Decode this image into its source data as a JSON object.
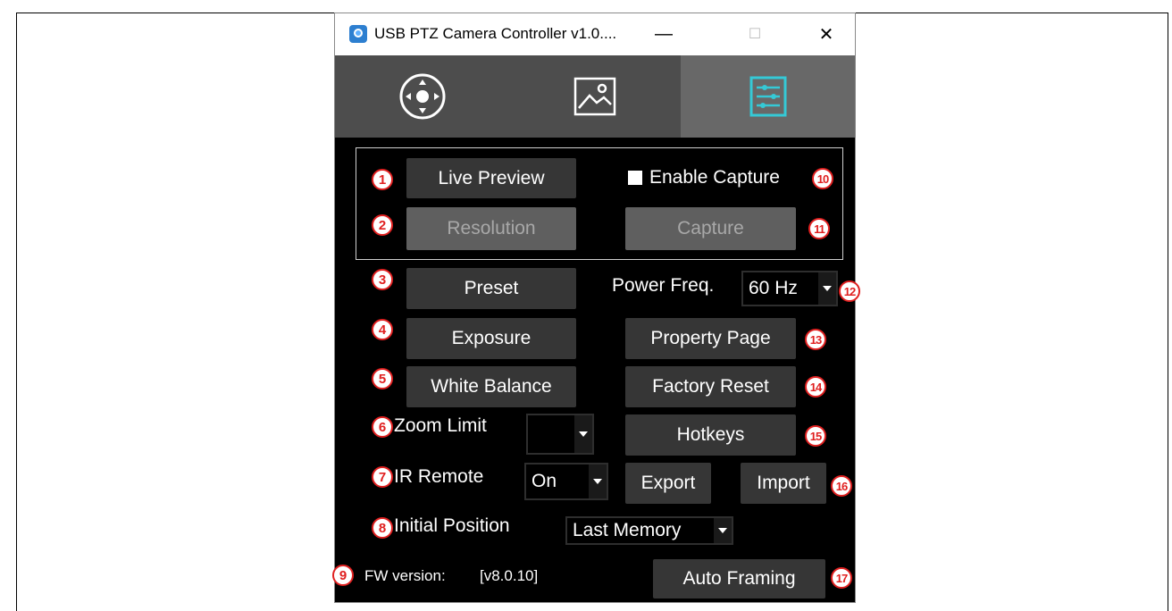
{
  "window": {
    "title": "USB PTZ Camera Controller v1.0....",
    "minimize": "—",
    "maximize": "☐",
    "close": "✕"
  },
  "tabs": [
    {
      "icon": "pan-tilt-control-icon"
    },
    {
      "icon": "image-icon"
    },
    {
      "icon": "settings-sliders-icon",
      "active": true
    }
  ],
  "capture_group": {
    "live_preview": "Live Preview",
    "resolution": "Resolution",
    "enable_capture": "Enable Capture",
    "enable_capture_checked": false,
    "capture": "Capture"
  },
  "left": {
    "preset": "Preset",
    "exposure": "Exposure",
    "white_balance": "White Balance",
    "zoom_limit_label": "Zoom Limit",
    "zoom_limit_value": "",
    "ir_remote_label": "IR Remote",
    "ir_remote_value": "On",
    "initial_position_label": "Initial Position",
    "initial_position_value": "Last Memory",
    "fw_label": "FW version:",
    "fw_value": "[v8.0.10]"
  },
  "right": {
    "power_freq_label": "Power Freq.",
    "power_freq_value": "60 Hz",
    "property_page": "Property Page",
    "factory_reset": "Factory Reset",
    "hotkeys": "Hotkeys",
    "export": "Export",
    "import": "Import",
    "auto_framing": "Auto Framing"
  },
  "callouts": [
    "1",
    "2",
    "3",
    "4",
    "5",
    "6",
    "7",
    "8",
    "9",
    "10",
    "11",
    "12",
    "13",
    "14",
    "15",
    "16",
    "17"
  ],
  "colors": {
    "callout": "#e02020",
    "button": "#363636",
    "active_tab_icon": "#35c9d6"
  }
}
